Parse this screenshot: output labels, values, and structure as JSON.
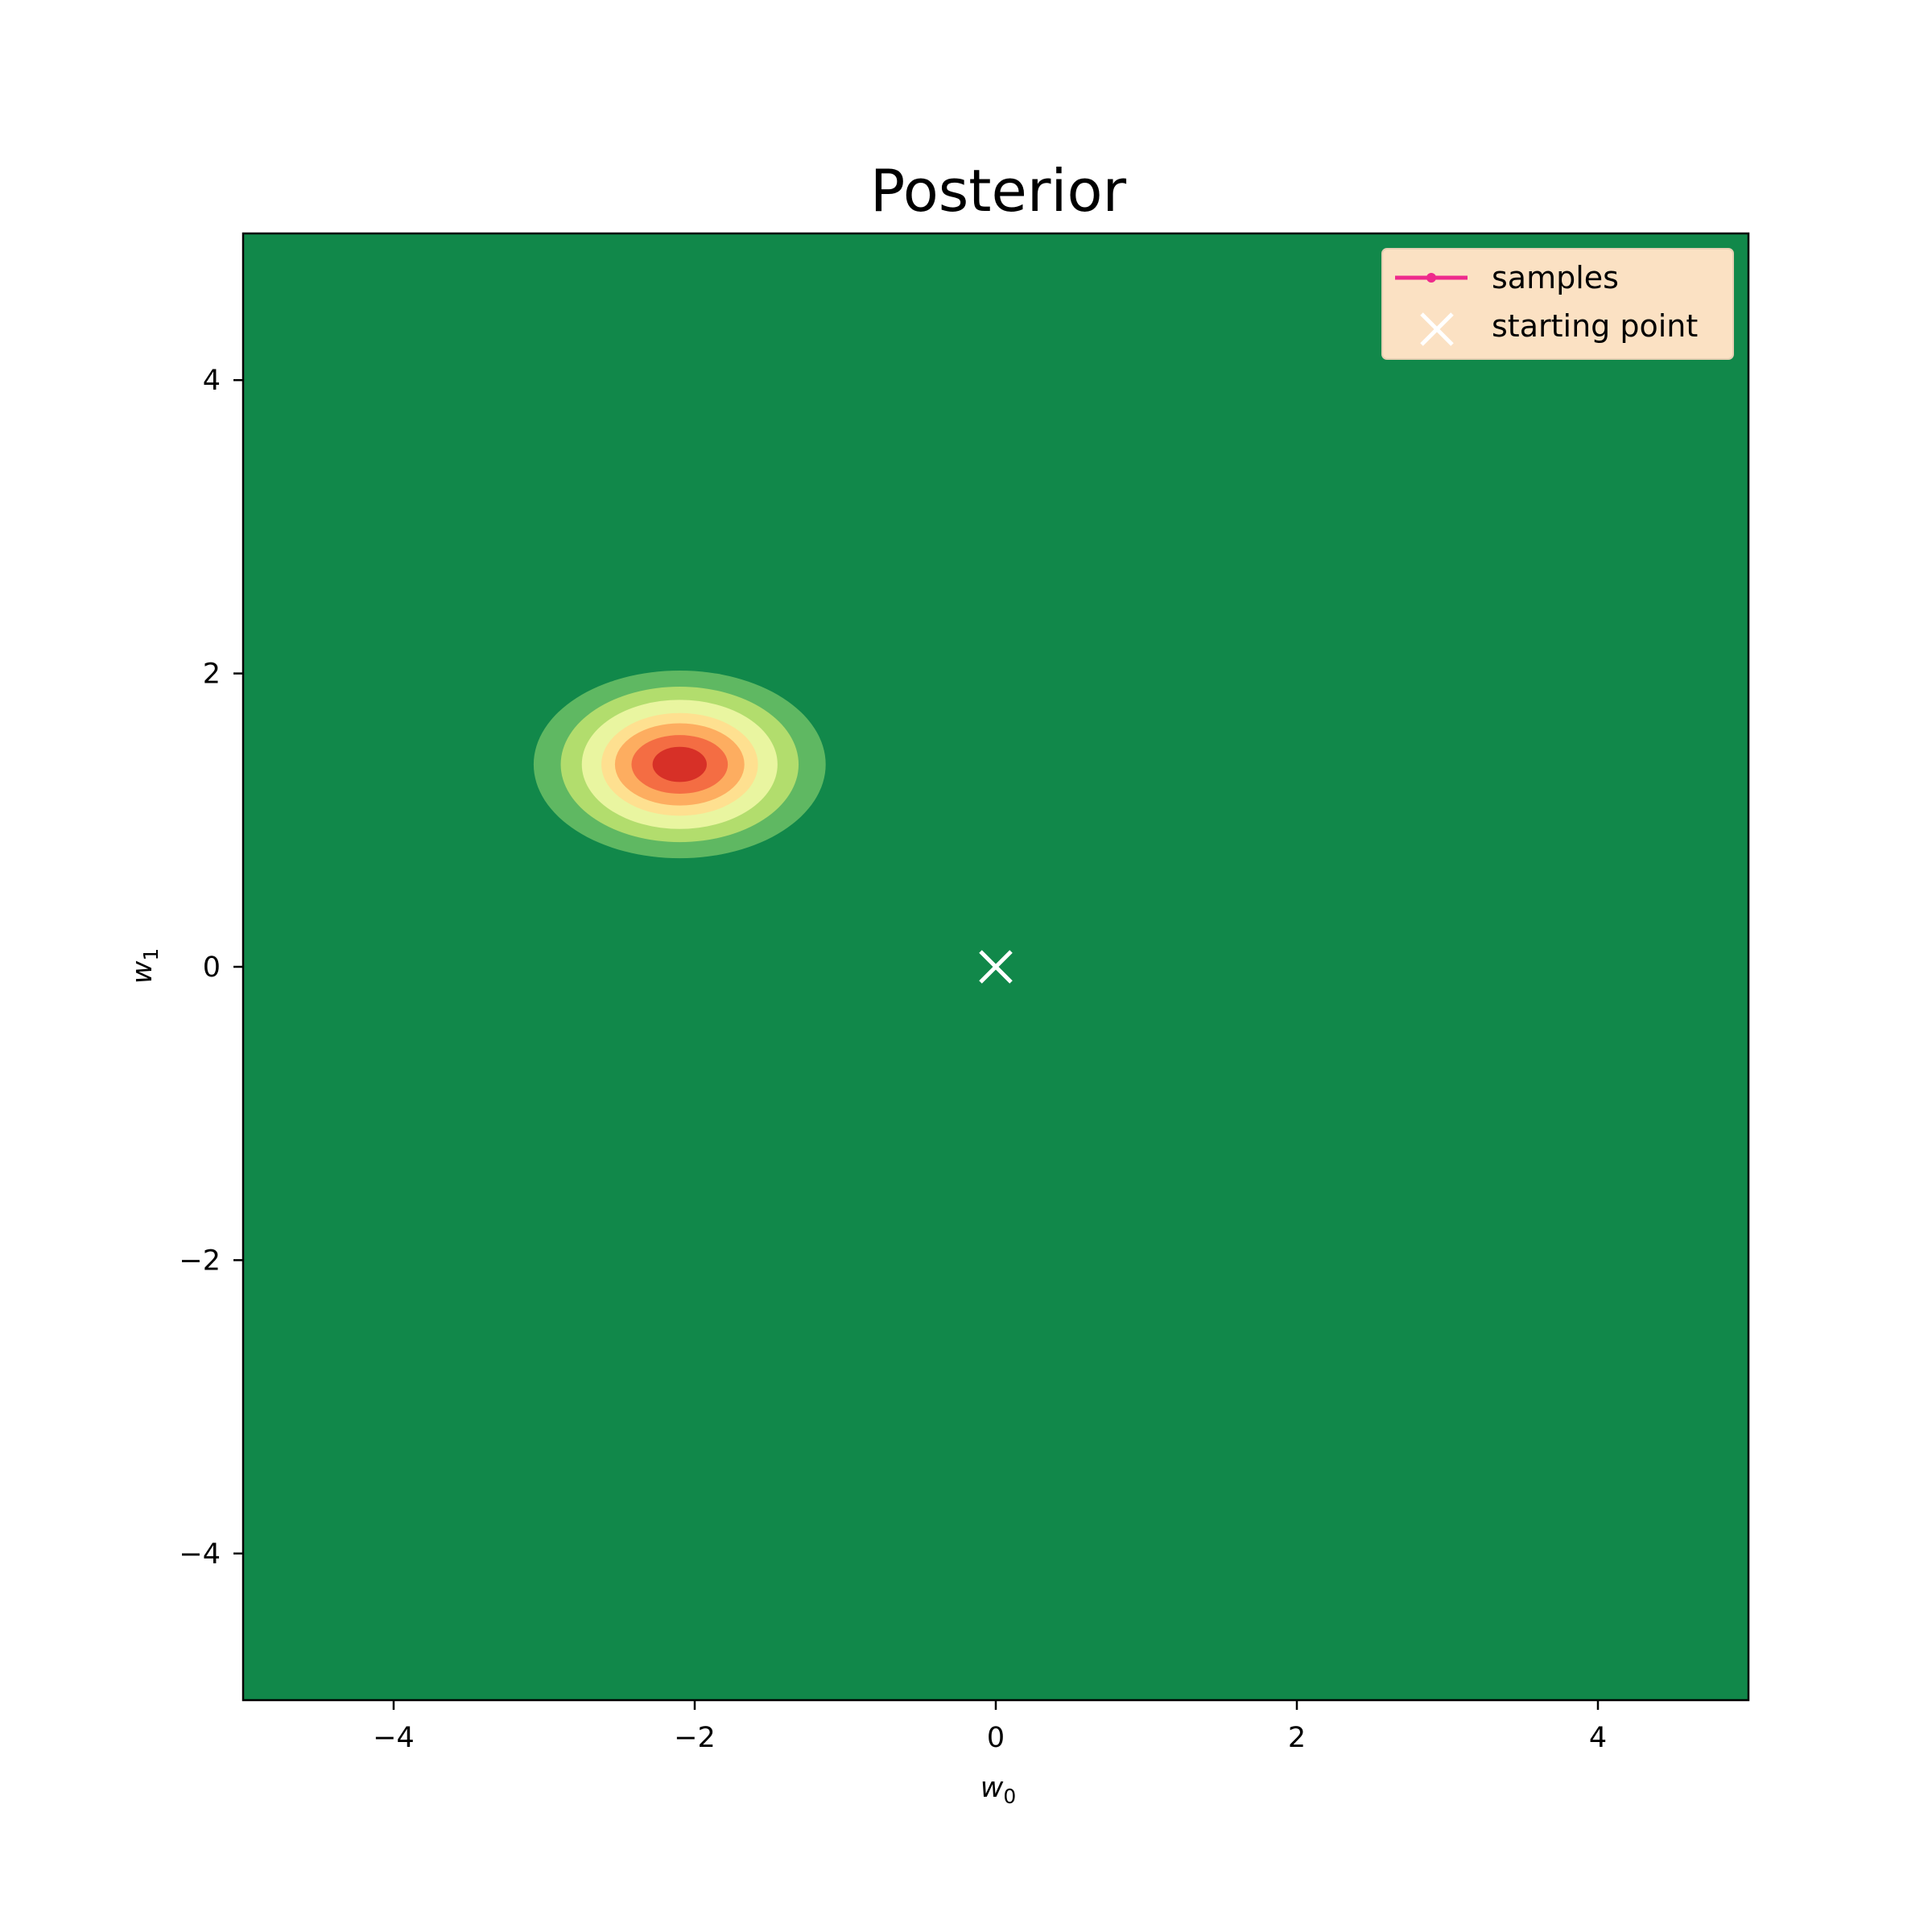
{
  "chart_data": {
    "type": "contour",
    "title": "Posterior",
    "xlabel": {
      "base": "w",
      "sub": "0"
    },
    "ylabel": {
      "base": "w",
      "sub": "1"
    },
    "xlim": [
      -5,
      5
    ],
    "ylim": [
      -5,
      5
    ],
    "xticks": [
      {
        "value": -4,
        "label": "−4"
      },
      {
        "value": -2,
        "label": "−2"
      },
      {
        "value": 0,
        "label": "0"
      },
      {
        "value": 2,
        "label": "2"
      },
      {
        "value": 4,
        "label": "4"
      }
    ],
    "yticks": [
      {
        "value": -4,
        "label": "−4"
      },
      {
        "value": -2,
        "label": "−2"
      },
      {
        "value": 0,
        "label": "0"
      },
      {
        "value": 2,
        "label": "2"
      },
      {
        "value": 4,
        "label": "4"
      }
    ],
    "grid": false,
    "background_color": "#11884a",
    "posterior": {
      "mean": [
        -2.1,
        1.38
      ],
      "levels": [
        {
          "rx": 0.97,
          "ry": 0.64,
          "color": "#5fb862"
        },
        {
          "rx": 0.79,
          "ry": 0.53,
          "color": "#b2dd6d"
        },
        {
          "rx": 0.65,
          "ry": 0.44,
          "color": "#e9f5a0"
        },
        {
          "rx": 0.52,
          "ry": 0.35,
          "color": "#fee090"
        },
        {
          "rx": 0.43,
          "ry": 0.28,
          "color": "#fdad60"
        },
        {
          "rx": 0.32,
          "ry": 0.2,
          "color": "#f46d43"
        },
        {
          "rx": 0.18,
          "ry": 0.12,
          "color": "#d73027"
        }
      ]
    },
    "starting_point": {
      "x": 0,
      "y": 0,
      "color": "#ffffff"
    },
    "legend": {
      "placement": "top-right",
      "background": "#fbe1c3",
      "entries": [
        {
          "label": "samples",
          "marker": "line-dot",
          "color": "#ee2a8c"
        },
        {
          "label": "starting point",
          "marker": "x",
          "color": "#ffffff"
        }
      ]
    }
  }
}
